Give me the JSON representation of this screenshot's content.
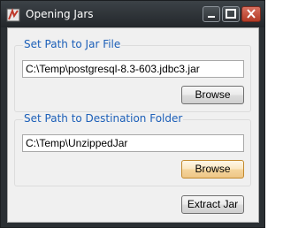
{
  "window": {
    "title": "Opening Jars",
    "controls": [
      "minimize-icon",
      "maximize-icon",
      "close-icon"
    ]
  },
  "jar_group": {
    "label": "Set Path to Jar File",
    "path_value": "C:\\Temp\\postgresql-8.3-603.jdbc3.jar",
    "browse_label": "Browse"
  },
  "dest_group": {
    "label": "Set Path to Destination Folder",
    "path_value": "C:\\Temp\\UnzippedJar",
    "browse_label": "Browse"
  },
  "actions": {
    "extract_label": "Extract Jar"
  }
}
